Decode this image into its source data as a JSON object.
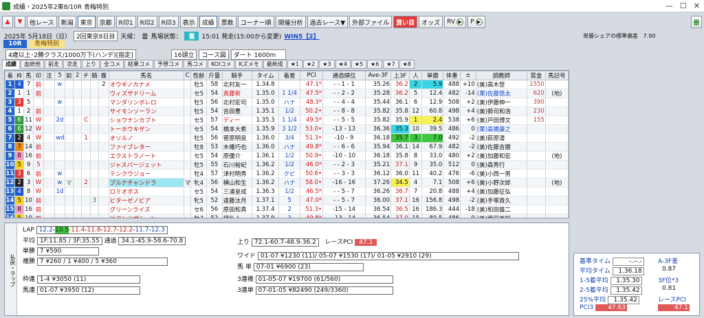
{
  "window": {
    "title": "成績・2025年2東8/10R 青梅特別",
    "min": "—",
    "max": "☐",
    "close": "✕"
  },
  "toolbar": {
    "buttons": [
      "他レース",
      "新潟",
      "東京",
      "京都",
      "R印1",
      "R印2",
      "R印3",
      "表示",
      "成績",
      "票数",
      "コーナー順",
      "開催分析",
      "過去レース▼",
      "外部ファイル",
      "買い目",
      "オッズ",
      "RV",
      "P"
    ]
  },
  "info": {
    "date": "2025年 5月18日（日）",
    "kai": "2回東京8日目",
    "weather_label": "天候：",
    "weather": "曇",
    "track_label": "馬場状態：",
    "track": "重",
    "post": "15:01 発走(15:00から変更)",
    "win5": "WIN5【2】",
    "sd_label": "単勝シェアの標準偏差",
    "sd_value": "7.90"
  },
  "race": {
    "no": "10R",
    "name": "青梅特別",
    "conditions": "4歳以上･2勝クラス/1000万下(ハンデ)[指定]",
    "heads": "16頭立",
    "course_btn": "コース図",
    "distance": "ダート 1600m"
  },
  "subtabs": [
    "成績",
    "血統他",
    "前走",
    "次走",
    "上り",
    "全コメ",
    "結果コメ",
    "予想コメ",
    "馬コメ",
    "KOIコメ",
    "Kズメモ",
    "最新成",
    "★1",
    "★2",
    "★3",
    "★4",
    "★5",
    "★6",
    "★7",
    "★8"
  ],
  "columns": [
    "着",
    "枠",
    "馬",
    "印",
    "注",
    "5",
    "前",
    "2",
    "チ",
    "騎",
    "履",
    "馬名",
    "C",
    "性齢",
    "斤量",
    "騎手",
    "タイム",
    "着差",
    "PCI",
    "通過順位",
    "Ave-3F",
    "上3F",
    "人",
    "単勝",
    "体重",
    "±",
    "調教師",
    "賞金",
    "馬記号"
  ],
  "rows": [
    [
      "1",
      "4",
      "7",
      "前",
      "",
      "w",
      "",
      "",
      "",
      "",
      "2",
      "オウギノカナメ",
      "",
      "牡5",
      "58",
      "北村友一",
      "1.34.8",
      "",
      "47.1",
      "-",
      "1",
      "1",
      "35.26",
      "36.2",
      "2",
      "5.9",
      "488",
      "+10",
      "(美)高木登",
      "1550",
      ""
    ],
    [
      "2",
      "1",
      "1",
      "前",
      "",
      "",
      "",
      "",
      "",
      "",
      "",
      "ウィズザドリーム",
      "",
      "セ5",
      "54",
      "斎藤新",
      "1.35.0",
      "1 1/4",
      "47.5",
      "-",
      "2",
      "2",
      "35.28",
      "36.2",
      "5",
      "12.4",
      "482",
      "-14",
      "(栗)佐藤悠太",
      "620",
      "(地)"
    ],
    [
      "3",
      "3",
      "5",
      "",
      "",
      "w",
      "",
      "",
      "",
      "",
      "",
      "マンダリンボレロ",
      "",
      "牡5",
      "56",
      "北村宏司",
      "1.35.0",
      "ハナ",
      "48.3",
      "-",
      "4",
      "4",
      "35.44",
      "36.1",
      "6",
      "12.9",
      "508",
      "+2",
      "(美)伊藤伸一",
      "390",
      ""
    ],
    [
      "4",
      "1",
      "2",
      "前",
      "",
      "",
      "",
      "",
      "",
      "",
      "",
      "サイモンソーラン",
      "",
      "牡5",
      "54",
      "吉田豊",
      "1.35.1",
      "1/2",
      "50.2",
      "-",
      "8",
      "8",
      "35.82",
      "35.8",
      "12",
      "60.8",
      "498",
      "+4",
      "(美)勢司和浩",
      "230",
      ""
    ],
    [
      "5",
      "6",
      "11",
      "W",
      "",
      "2d",
      "",
      "",
      "C",
      "",
      "",
      "ショウナンカブト",
      "",
      "セ5",
      "57",
      "ディー",
      "1.35.3",
      "1 1/4",
      "49.5",
      "-",
      "5",
      "5",
      "35.82",
      "35.9",
      "1",
      "2.4",
      "538",
      "+6",
      "(美)戸田博文",
      "155",
      ""
    ],
    [
      "6",
      "6",
      "12",
      "W",
      "",
      "",
      "",
      "",
      "",
      "",
      "",
      "トーホウキザン",
      "",
      "セ5",
      "54",
      "橋本大希",
      "1.35.9",
      "3 1/2",
      "53.0",
      "-13",
      "13",
      "",
      "36.36",
      "35.3",
      "10",
      "39.5",
      "486",
      "0",
      "(栗)高橋康之",
      "",
      ""
    ],
    [
      "7",
      "2",
      "4",
      "W",
      "",
      "wd",
      "",
      "",
      "1",
      "",
      "",
      "オソルノ",
      "",
      "牡5",
      "56",
      "菅原明良",
      "1.36.0",
      "3/4",
      "51.3",
      "-10",
      "9",
      "",
      "36.18",
      "35.7",
      "3",
      "7.0",
      "492",
      "-2",
      "(美)萩原清",
      "",
      ""
    ],
    [
      "8",
      "7",
      "14",
      "前",
      "",
      "",
      "",
      "",
      "",
      "",
      "",
      "ファイブレター",
      "",
      "牡8",
      "53",
      "木幡巧也",
      "1.36.0",
      "ハナ",
      "49.8",
      "-",
      "6",
      "6",
      "35.94",
      "36.1",
      "14",
      "67.9",
      "482",
      "-2",
      "(美)佐藤吉勝",
      "",
      ""
    ],
    [
      "9",
      "8",
      "16",
      "前",
      "",
      "",
      "",
      "",
      "",
      "",
      "",
      "エクストラノート",
      "",
      "セ5",
      "54",
      "原優介",
      "1.36.1",
      "1/2",
      "50.9",
      "-10",
      "10",
      "",
      "36.18",
      "35.8",
      "8",
      "33.0",
      "480",
      "+2",
      "(美)加藤和宏",
      "",
      "(地)"
    ],
    [
      "10",
      "5",
      "9",
      "5",
      "",
      "",
      "",
      "",
      "",
      "",
      "",
      "ジャスパージェット",
      "",
      "牡5",
      "55",
      "石川裕紀",
      "1.36.2",
      "1/2",
      "46.0",
      "-",
      "2",
      "3",
      "35.21",
      "37.1",
      "9",
      "35.0",
      "512",
      "0",
      "(美)森秀行",
      "",
      ""
    ],
    [
      "11",
      "3",
      "6",
      "前",
      "",
      "w",
      "",
      "",
      "",
      "",
      "",
      "テンクウジョー",
      "",
      "牡4",
      "57",
      "津村明秀",
      "1.36.2",
      "クビ",
      "50.6",
      "-",
      "3",
      "3",
      "36.12",
      "36.0",
      "11",
      "40.2",
      "476",
      "-6",
      "(美)小西一男",
      "",
      ""
    ],
    [
      "12",
      "2",
      "3",
      "W",
      "",
      "w",
      "マ",
      "",
      "2",
      "",
      "",
      "ブルナチャンドラ",
      "マ",
      "牝4",
      "56",
      "横山和生",
      "1.36.2",
      "ハナ",
      "58.0",
      "-16",
      "16",
      "",
      "37.26",
      "34.5",
      "4",
      "7.1",
      "508",
      "+6",
      "(美)小野次郎",
      "",
      "(地)"
    ],
    [
      "13",
      "4",
      "8",
      "W",
      "",
      "1d",
      "",
      "",
      "",
      "",
      "",
      "ロミオボス",
      "",
      "セ5",
      "54",
      "三浦皇成",
      "1.36.3",
      "1/2",
      "46.5",
      "-",
      "5",
      "7",
      "36.26",
      "36.7",
      "7",
      "20.8",
      "488",
      "+4",
      "(美)加藤征弘",
      "",
      ""
    ],
    [
      "14",
      "5",
      "10",
      "前",
      "",
      "",
      "",
      "",
      "",
      "3",
      "",
      "ビターゼノビア",
      "",
      "牝5",
      "52",
      "遠藤汰月",
      "1.37.1",
      "5",
      "47.0",
      "-",
      "5",
      "7",
      "36.00",
      "37.1",
      "16",
      "156.8",
      "498",
      "-2",
      "(美)手塚貴久",
      "",
      ""
    ],
    [
      "15",
      "8",
      "16",
      "前",
      "",
      "",
      "",
      "",
      "",
      "",
      "",
      "グリーンライズ",
      "",
      "セ6",
      "56",
      "原田和真",
      "1.37.4",
      "2",
      "51.3",
      "-15",
      "14",
      "",
      "36.54",
      "36.5",
      "16",
      "186.3",
      "444",
      "-18",
      "(美)和田雄二",
      "",
      ""
    ],
    [
      "16",
      "5",
      "10",
      "前",
      "",
      "",
      "",
      "",
      "",
      "",
      "",
      "ビヨンドザシーン",
      "",
      "牡7",
      "52",
      "黛弘人",
      "1.37.9",
      "3",
      "49.8",
      "-13",
      "14",
      "",
      "36.54",
      "37.0",
      "15",
      "80.5",
      "486",
      "0",
      "(美)南田美知",
      "",
      ""
    ]
  ],
  "bottom": {
    "side_label": "払戻・ラップ",
    "lap_label": "LAP",
    "lap": [
      "12.2",
      "10.5",
      "11.4",
      "11.8",
      "12.7",
      "12.2",
      "11.7",
      "12.3"
    ],
    "avg_label": "平均",
    "avg_text": "1F:11.85 / 3F:35.55",
    "pass_label": "通過",
    "pass_text": "34.1-45.9-58.6-70.8",
    "agari_label": "上り",
    "agari_text": "72.1-60.7-48.9-36.2",
    "racepci_label": "レースPCI",
    "racepci": "47.1",
    "tansho_label": "単勝",
    "tansho": "7 ¥590",
    "fukusho_label": "複勝",
    "fukusho": "7 ¥260 / 1 ¥400 / 5 ¥360",
    "wakuren_label": "枠連",
    "wakuren": "1-4 ¥3050 (11)",
    "umaren_label": "馬連",
    "umaren": "01-07 ¥3950 (12)",
    "wide_label": "ワイド",
    "wide": "01-07 ¥1230 (11)/ 05-07 ¥1530 (17)/ 01-05 ¥2910 (29)",
    "umatan_label": "馬 単",
    "umatan": "07-01 ¥6900 (23)",
    "sanrenpuku_label": "3連複",
    "sanrenpuku": "01-05-07 ¥19700 (61/560)",
    "sanrentan_label": "3連単",
    "sanrentan": "07-01-05 ¥82490 (249/3360)"
  },
  "stats": {
    "kijun_label": "基準タイム",
    "kijun": "-.--.-",
    "a3f_label": "A-3F差",
    "a3f": "0.87",
    "heikin_label": "平均タイム",
    "heikin": "1.36.18",
    "r15_label": "1-5着平均",
    "r15": "1.35.30",
    "sanf_label": "3F位*3",
    "sanf": "0.81",
    "r25_label": "2-5着平均",
    "r25": "1.35.42",
    "rpci_label": "レースPCI",
    "p25_label": "25%平均",
    "p25": "1.35.42",
    "rpci": "47.1",
    "pci3_label": "PCI3",
    "pci3": "47.63"
  },
  "colors": {
    "waku": [
      "#ffffff",
      "#222222",
      "#e53935",
      "#1e56d6",
      "#f6d21c",
      "#2e9d3a",
      "#f08a1a",
      "#f29ac0"
    ]
  }
}
